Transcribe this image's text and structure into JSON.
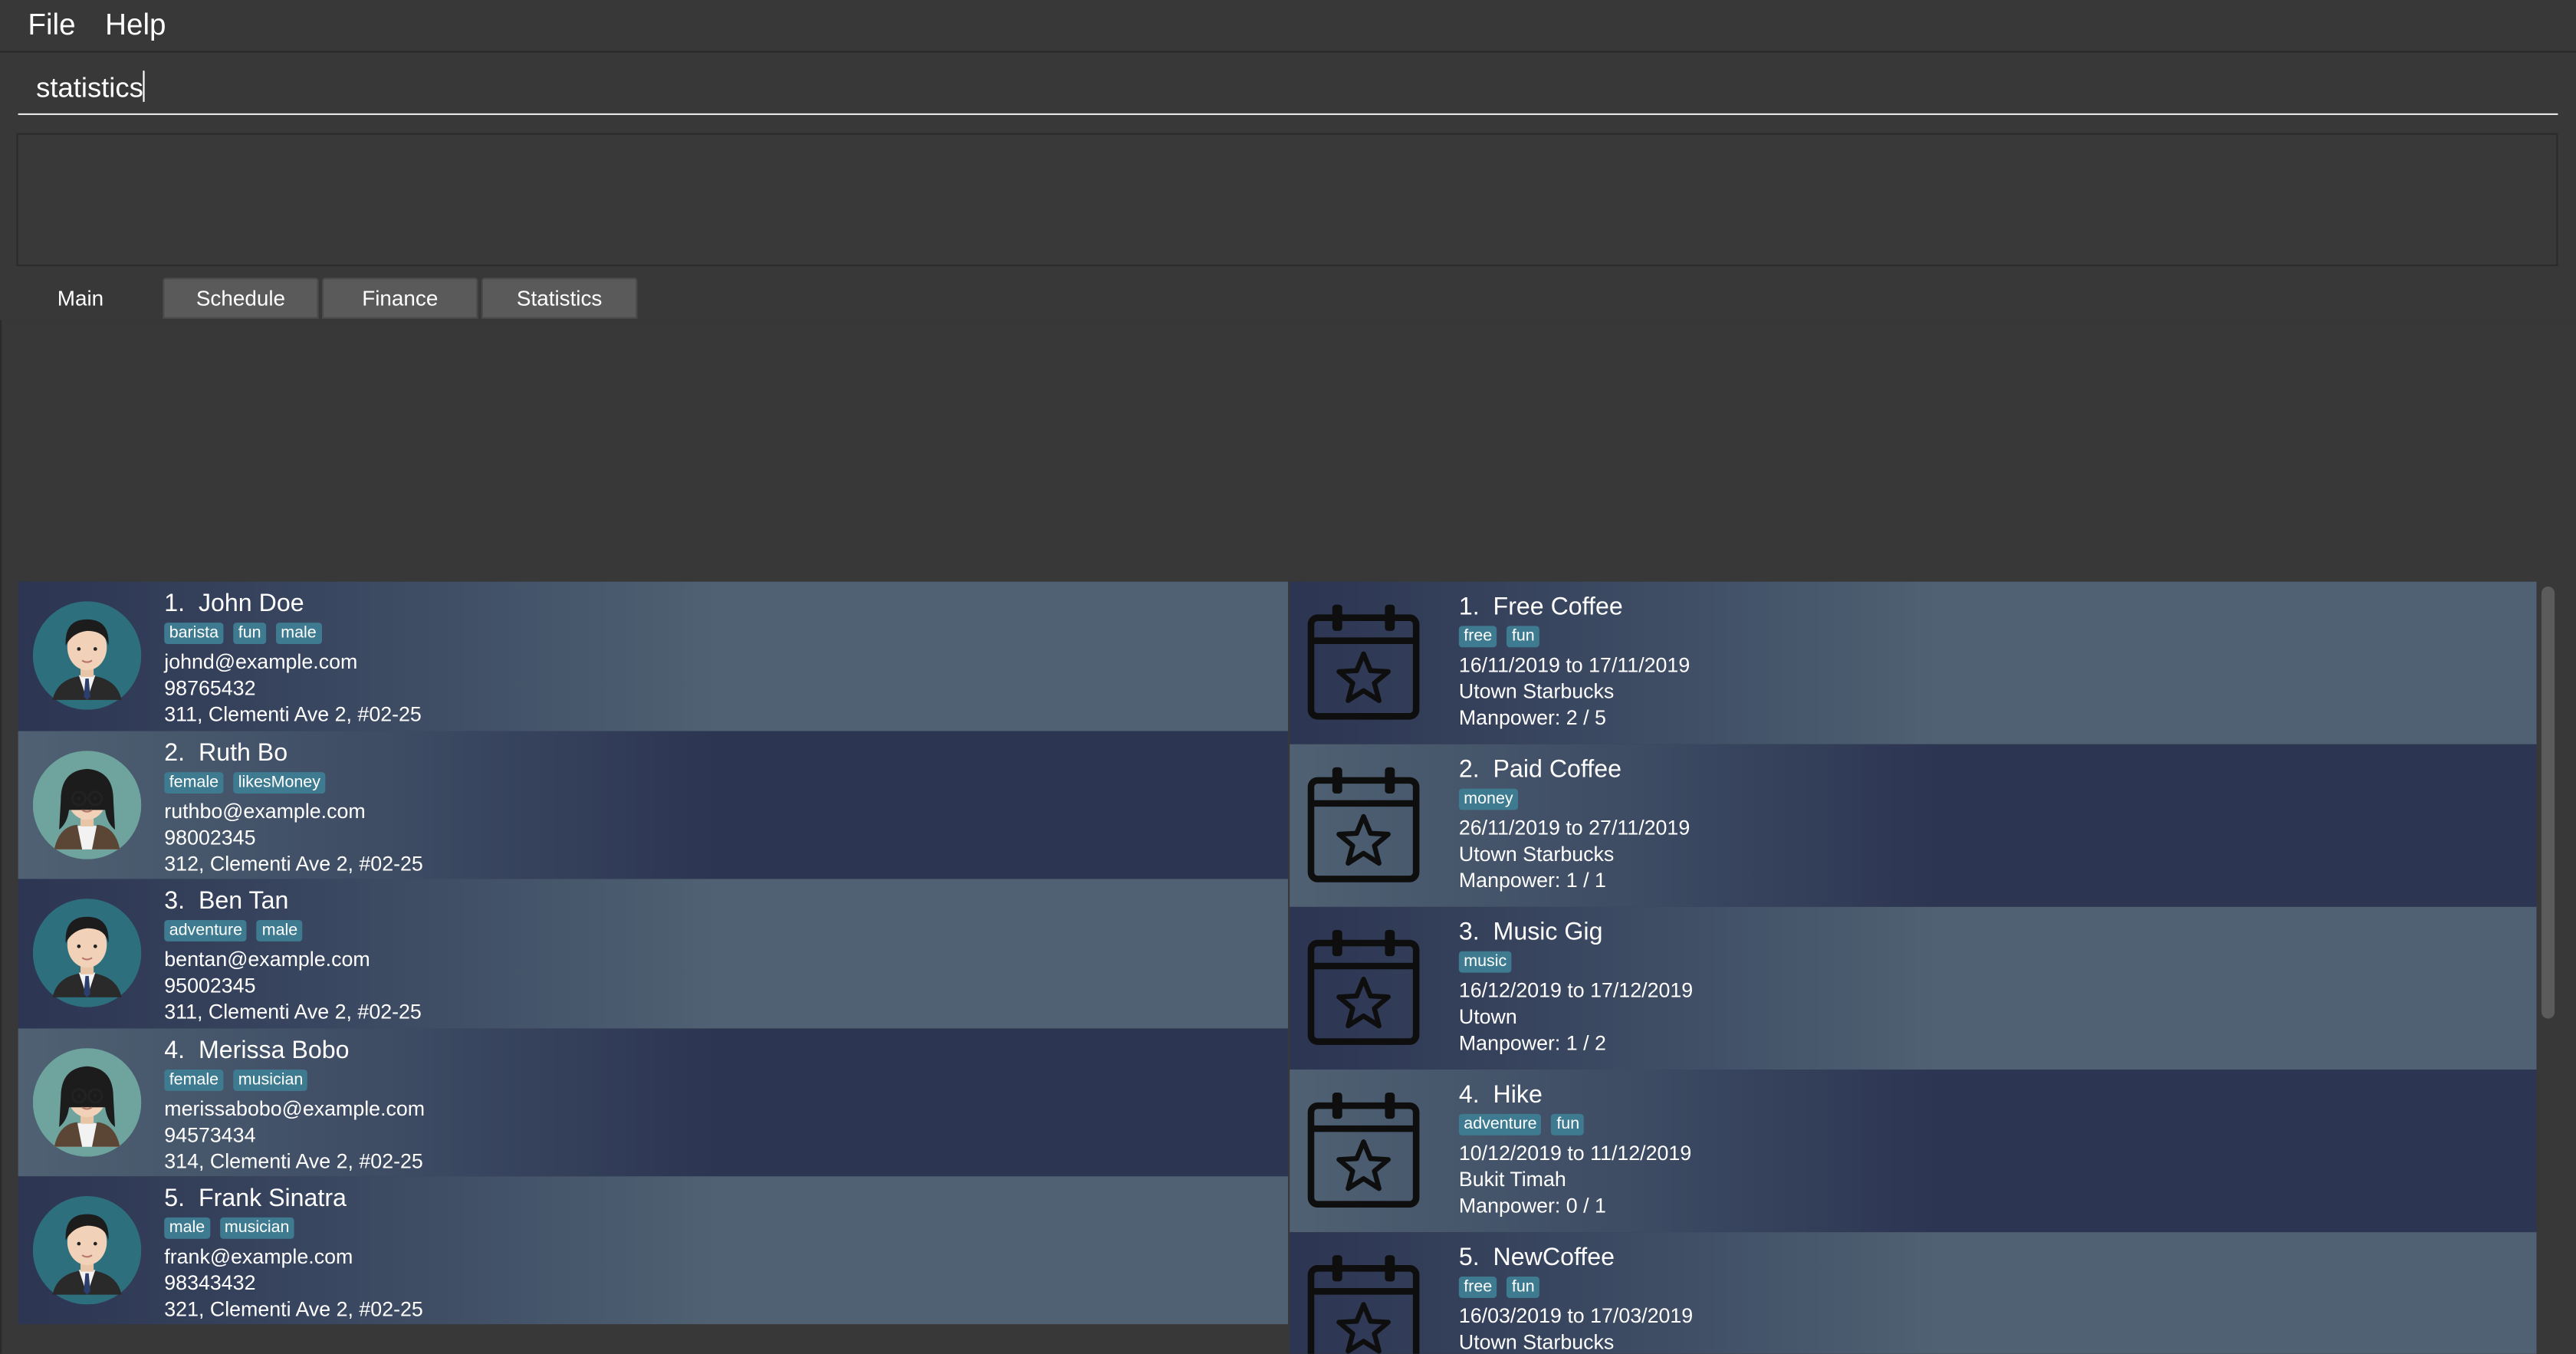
{
  "menu": {
    "file": "File",
    "help": "Help"
  },
  "command": {
    "value": "statistics"
  },
  "tabs": [
    {
      "label": "Main"
    },
    {
      "label": "Schedule"
    },
    {
      "label": "Finance"
    },
    {
      "label": "Statistics"
    }
  ],
  "persons": [
    {
      "index": "1.",
      "name": "John Doe",
      "tags": [
        "barista",
        "fun",
        "male"
      ],
      "email": "johnd@example.com",
      "phone": "98765432",
      "address": "311, Clementi Ave 2, #02-25",
      "gender": "male"
    },
    {
      "index": "2.",
      "name": "Ruth Bo",
      "tags": [
        "female",
        "likesMoney"
      ],
      "email": "ruthbo@example.com",
      "phone": "98002345",
      "address": "312, Clementi Ave 2, #02-25",
      "gender": "female"
    },
    {
      "index": "3.",
      "name": "Ben Tan",
      "tags": [
        "adventure",
        "male"
      ],
      "email": "bentan@example.com",
      "phone": "95002345",
      "address": "311, Clementi Ave 2, #02-25",
      "gender": "male"
    },
    {
      "index": "4.",
      "name": "Merissa Bobo",
      "tags": [
        "female",
        "musician"
      ],
      "email": "merissabobo@example.com",
      "phone": "94573434",
      "address": "314, Clementi Ave 2, #02-25",
      "gender": "female"
    },
    {
      "index": "5.",
      "name": "Frank Sinatra",
      "tags": [
        "male",
        "musician"
      ],
      "email": "frank@example.com",
      "phone": "98343432",
      "address": "321, Clementi Ave 2, #02-25",
      "gender": "male"
    }
  ],
  "events": [
    {
      "index": "1.",
      "name": "Free Coffee",
      "tags": [
        "free",
        "fun"
      ],
      "dates": "16/11/2019 to 17/11/2019",
      "venue": "Utown Starbucks",
      "manpower": "Manpower: 2 / 5"
    },
    {
      "index": "2.",
      "name": "Paid Coffee",
      "tags": [
        "money"
      ],
      "dates": "26/11/2019 to 27/11/2019",
      "venue": "Utown Starbucks",
      "manpower": "Manpower: 1 / 1"
    },
    {
      "index": "3.",
      "name": "Music Gig",
      "tags": [
        "music"
      ],
      "dates": "16/12/2019 to 17/12/2019",
      "venue": "Utown",
      "manpower": "Manpower: 1 / 2"
    },
    {
      "index": "4.",
      "name": "Hike",
      "tags": [
        "adventure",
        "fun"
      ],
      "dates": "10/12/2019 to 11/12/2019",
      "venue": "Bukit Timah",
      "manpower": "Manpower: 0 / 1"
    },
    {
      "index": "5.",
      "name": "NewCoffee",
      "tags": [
        "free",
        "fun"
      ],
      "dates": "16/03/2019 to 17/03/2019",
      "venue": "Utown Starbucks",
      "manpower": ""
    }
  ]
}
